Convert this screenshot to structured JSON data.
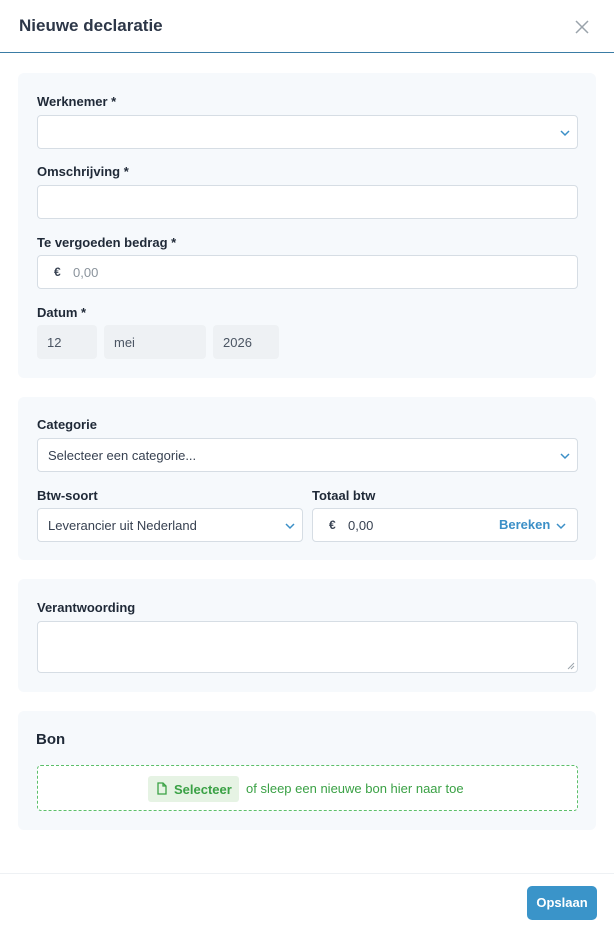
{
  "modal": {
    "title": "Nieuwe declaratie",
    "close_icon": "close-icon"
  },
  "section_main": {
    "employee": {
      "label": "Werknemer *",
      "value": ""
    },
    "description": {
      "label": "Omschrijving *",
      "value": ""
    },
    "amount": {
      "label": "Te vergoeden bedrag *",
      "currency": "€",
      "placeholder": "0,00"
    },
    "date": {
      "label": "Datum *",
      "day": "12",
      "month": "mei",
      "year": "2026"
    }
  },
  "section_category": {
    "category": {
      "label": "Categorie",
      "value": "Selecteer een categorie..."
    },
    "vat_type": {
      "label": "Btw-soort",
      "value": "Leverancier uit Nederland"
    },
    "vat_total": {
      "label": "Totaal btw",
      "currency": "€",
      "value": "0,00",
      "calculate_label": "Bereken"
    }
  },
  "section_justification": {
    "label": "Verantwoording",
    "value": ""
  },
  "section_receipt": {
    "title": "Bon",
    "select_label": "Selecteer",
    "drop_hint": "of sleep een nieuwe bon hier naar toe"
  },
  "footer": {
    "save_label": "Opslaan"
  },
  "colors": {
    "accent": "#3a94c9",
    "link": "#3b8fc7",
    "upload_green": "#3aa145",
    "section_bg": "#f6f9fc"
  }
}
